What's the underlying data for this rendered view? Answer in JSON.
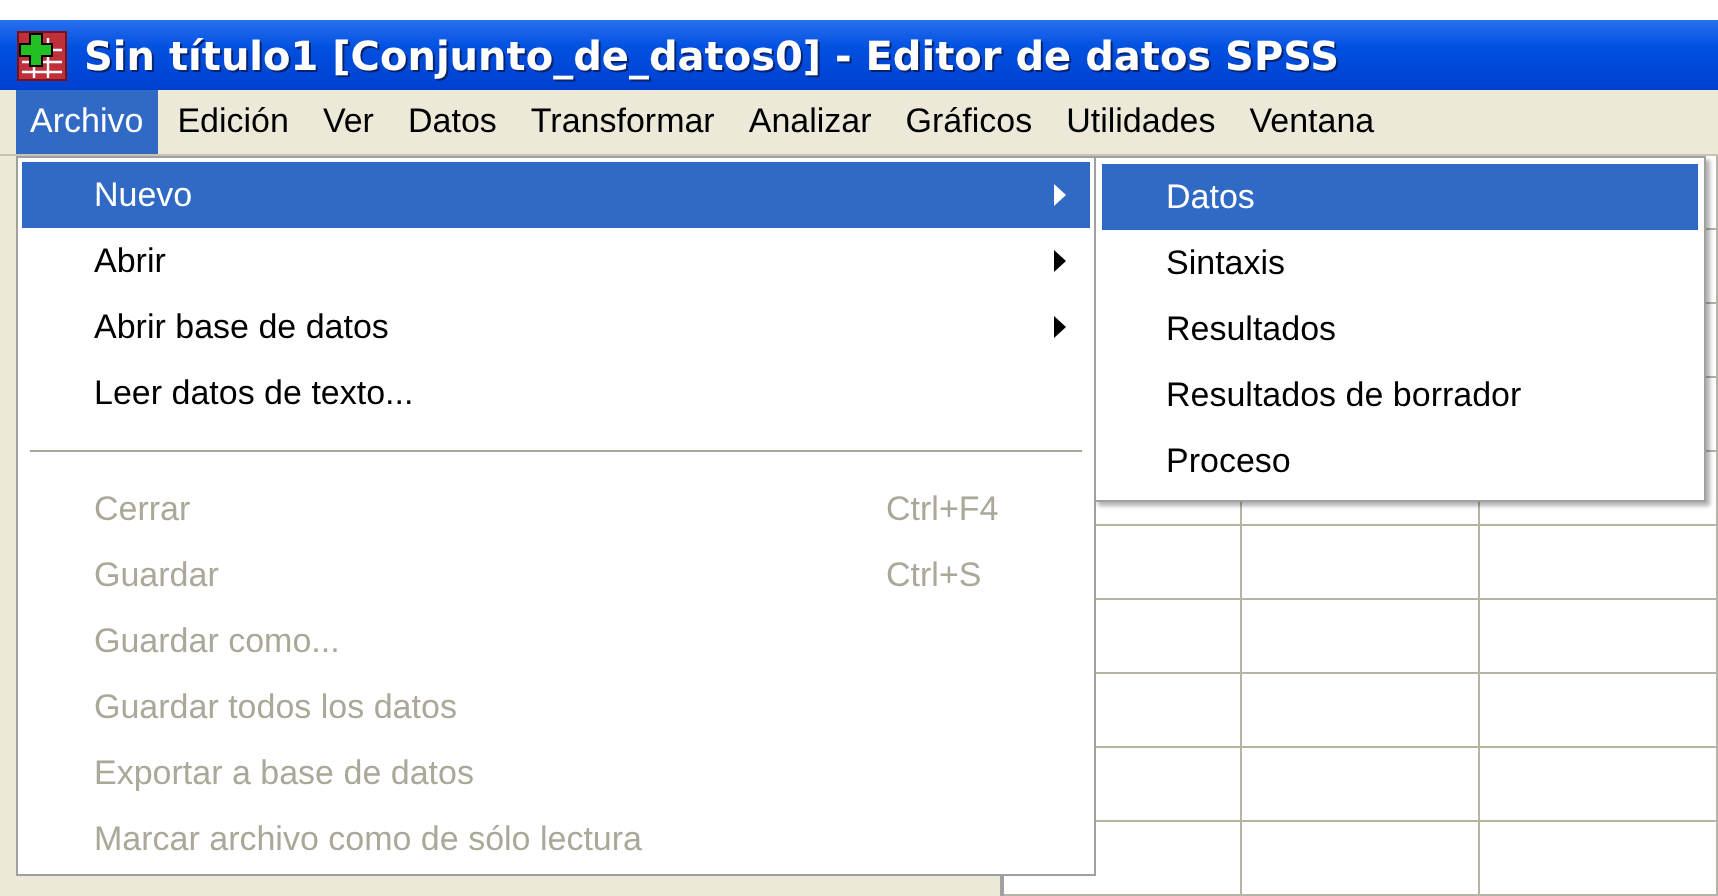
{
  "window": {
    "title": "Sin título1 [Conjunto_de_datos0] - Editor de datos SPSS"
  },
  "menubar": [
    {
      "label": "Archivo",
      "selected": true
    },
    {
      "label": "Edición",
      "selected": false
    },
    {
      "label": "Ver",
      "selected": false
    },
    {
      "label": "Datos",
      "selected": false
    },
    {
      "label": "Transformar",
      "selected": false
    },
    {
      "label": "Analizar",
      "selected": false
    },
    {
      "label": "Gráficos",
      "selected": false
    },
    {
      "label": "Utilidades",
      "selected": false
    },
    {
      "label": "Ventana",
      "selected": false
    }
  ],
  "file_menu": [
    {
      "kind": "item",
      "label": "Nuevo",
      "selected": true,
      "disabled": false,
      "submenu": true
    },
    {
      "kind": "item",
      "label": "Abrir",
      "selected": false,
      "disabled": false,
      "submenu": true
    },
    {
      "kind": "item",
      "label": "Abrir base de datos",
      "selected": false,
      "disabled": false,
      "submenu": true
    },
    {
      "kind": "item",
      "label": "Leer datos de texto...",
      "selected": false,
      "disabled": false,
      "submenu": false
    },
    {
      "kind": "separator"
    },
    {
      "kind": "item",
      "label": "Cerrar",
      "shortcut": "Ctrl+F4",
      "selected": false,
      "disabled": true,
      "submenu": false
    },
    {
      "kind": "item",
      "label": "Guardar",
      "shortcut": "Ctrl+S",
      "selected": false,
      "disabled": true,
      "submenu": false
    },
    {
      "kind": "item",
      "label": "Guardar como...",
      "selected": false,
      "disabled": true,
      "submenu": false
    },
    {
      "kind": "item",
      "label": "Guardar todos los datos",
      "selected": false,
      "disabled": true,
      "submenu": false
    },
    {
      "kind": "item",
      "label": "Exportar a base de datos",
      "selected": false,
      "disabled": true,
      "submenu": false
    },
    {
      "kind": "item",
      "label": "Marcar archivo como de sólo lectura",
      "selected": false,
      "disabled": true,
      "submenu": false
    }
  ],
  "new_submenu": [
    {
      "label": "Datos",
      "selected": true
    },
    {
      "label": "Sintaxis",
      "selected": false
    },
    {
      "label": "Resultados",
      "selected": false
    },
    {
      "label": "Resultados de borrador",
      "selected": false
    },
    {
      "label": "Proceso",
      "selected": false
    }
  ]
}
